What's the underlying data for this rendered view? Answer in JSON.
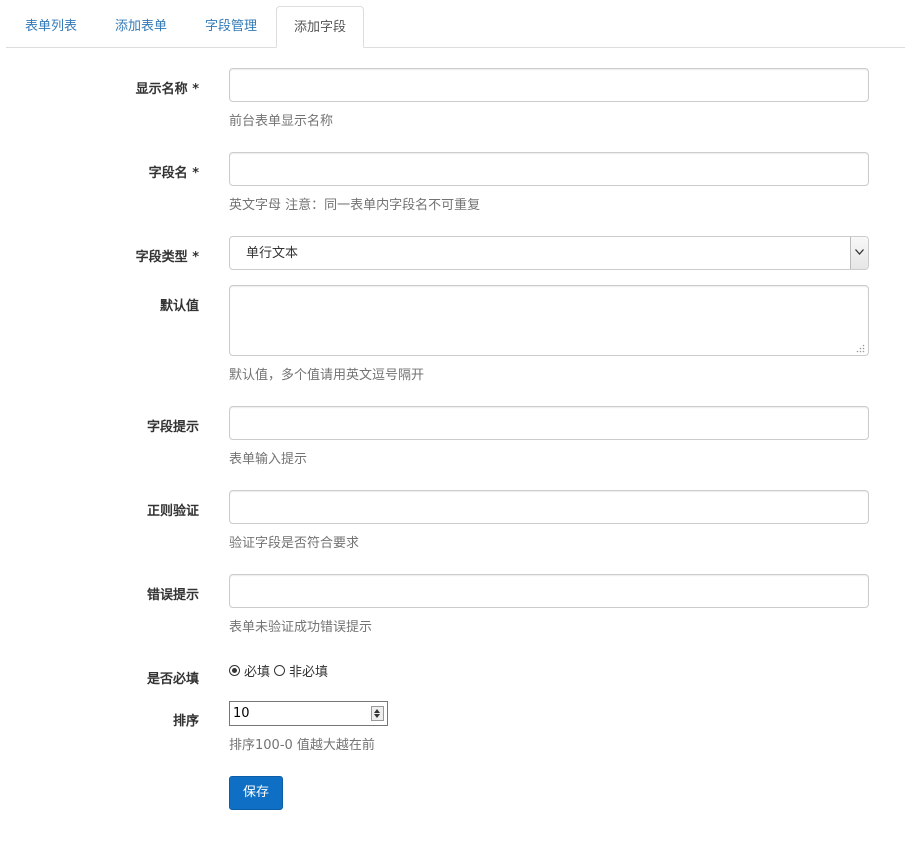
{
  "tabs": [
    {
      "label": "表单列表",
      "active": false
    },
    {
      "label": "添加表单",
      "active": false
    },
    {
      "label": "字段管理",
      "active": false
    },
    {
      "label": "添加字段",
      "active": true
    }
  ],
  "form": {
    "display_name": {
      "label": "显示名称 *",
      "value": "",
      "help": "前台表单显示名称"
    },
    "field_name": {
      "label": "字段名 *",
      "value": "",
      "help": "英文字母 注意：同一表单内字段名不可重复"
    },
    "field_type": {
      "label": "字段类型 *",
      "selected": "单行文本"
    },
    "default_value": {
      "label": "默认值",
      "value": "",
      "help": "默认值，多个值请用英文逗号隔开"
    },
    "field_hint": {
      "label": "字段提示",
      "value": "",
      "help": "表单输入提示"
    },
    "regex": {
      "label": "正则验证",
      "value": "",
      "help": "验证字段是否符合要求"
    },
    "error_hint": {
      "label": "错误提示",
      "value": "",
      "help": "表单未验证成功错误提示"
    },
    "required": {
      "label": "是否必填",
      "options": [
        "必填",
        "非必填"
      ],
      "selected": "必填"
    },
    "sort": {
      "label": "排序",
      "value": "10",
      "help": "排序100-0 值越大越在前"
    }
  },
  "save_label": "保存",
  "colors": {
    "link": "#337ab7",
    "primary_button": "#0e6fc4",
    "help_text": "#737373"
  }
}
